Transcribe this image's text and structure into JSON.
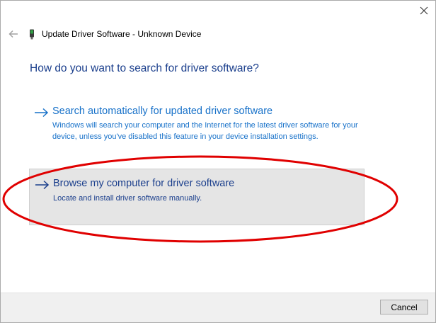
{
  "window": {
    "title": "Update Driver Software - Unknown Device",
    "back_icon": "back-arrow-icon",
    "device_icon": "device-icon",
    "close_icon": "close-icon"
  },
  "main": {
    "heading": "How do you want to search for driver software?",
    "options": [
      {
        "icon": "arrow-right-icon",
        "title": "Search automatically for updated driver software",
        "description": "Windows will search your computer and the Internet for the latest driver software for your device, unless you've disabled this feature in your device installation settings."
      },
      {
        "icon": "arrow-right-icon",
        "title": "Browse my computer for driver software",
        "description": "Locate and install driver software manually."
      }
    ]
  },
  "footer": {
    "cancel_label": "Cancel"
  },
  "colors": {
    "heading_blue": "#1a3e8c",
    "link_blue": "#1771c9",
    "annotation_red": "#e00000",
    "highlight_bg": "#e5e5e5",
    "footer_bg": "#f0f0f0"
  }
}
